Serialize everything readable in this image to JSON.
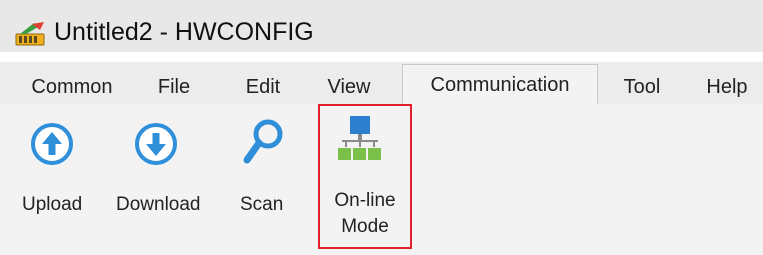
{
  "window": {
    "title": "Untitled2 - HWCONFIG",
    "icon": "hwconfig-app-icon"
  },
  "menu": {
    "tabs": [
      {
        "label": "Common",
        "active": false
      },
      {
        "label": "File",
        "active": false
      },
      {
        "label": "Edit",
        "active": false
      },
      {
        "label": "View",
        "active": false
      },
      {
        "label": "Communication",
        "active": true
      },
      {
        "label": "Tool",
        "active": false
      },
      {
        "label": "Help",
        "active": false
      }
    ]
  },
  "ribbon": {
    "buttons": [
      {
        "label": "Upload",
        "icon": "upload-arrow-icon"
      },
      {
        "label": "Download",
        "icon": "download-arrow-icon"
      },
      {
        "label": "Scan",
        "icon": "magnifier-icon"
      },
      {
        "label_line1": "On-line",
        "label_line2": "Mode",
        "icon": "network-online-icon",
        "highlighted": true
      }
    ]
  },
  "colors": {
    "icon_blue": "#2f8fd8",
    "network_green": "#7ac04a",
    "highlight_red": "#e0202c"
  }
}
